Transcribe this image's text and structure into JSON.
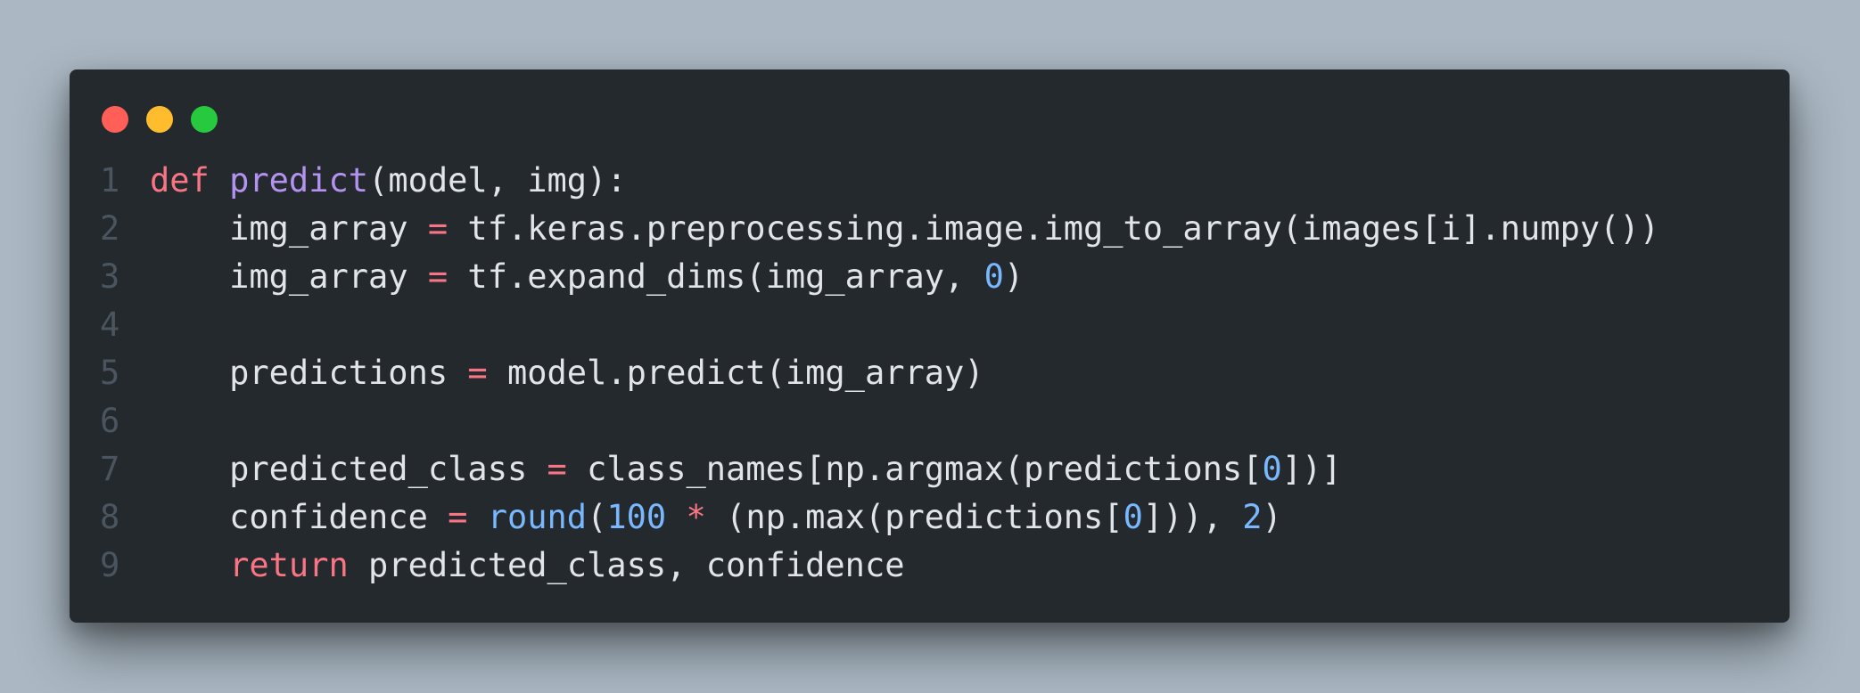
{
  "window": {
    "controls": [
      {
        "name": "close",
        "color": "#ff5f56"
      },
      {
        "name": "minimize",
        "color": "#ffbd2e"
      },
      {
        "name": "maximize",
        "color": "#27c93f"
      }
    ]
  },
  "colors": {
    "background": "#abb8c3",
    "editor_bg": "#24292e",
    "default": "#e1e4e8",
    "keyword": "#f97583",
    "function": "#b392f0",
    "number": "#79b8ff",
    "line_number": "#4b555f"
  },
  "code": {
    "lines": [
      {
        "num": "1",
        "tokens": [
          {
            "t": "def",
            "c": "keyword"
          },
          {
            "t": " ",
            "c": "default"
          },
          {
            "t": "predict",
            "c": "function"
          },
          {
            "t": "(model, img):",
            "c": "default"
          }
        ]
      },
      {
        "num": "2",
        "tokens": [
          {
            "t": "    img_array ",
            "c": "default"
          },
          {
            "t": "=",
            "c": "keyword"
          },
          {
            "t": " tf.keras.preprocessing.image.img_to_array(images[i].numpy())",
            "c": "default"
          }
        ]
      },
      {
        "num": "3",
        "tokens": [
          {
            "t": "    img_array ",
            "c": "default"
          },
          {
            "t": "=",
            "c": "keyword"
          },
          {
            "t": " tf.expand_dims(img_array, ",
            "c": "default"
          },
          {
            "t": "0",
            "c": "number"
          },
          {
            "t": ")",
            "c": "default"
          }
        ]
      },
      {
        "num": "4",
        "tokens": []
      },
      {
        "num": "5",
        "tokens": [
          {
            "t": "    predictions ",
            "c": "default"
          },
          {
            "t": "=",
            "c": "keyword"
          },
          {
            "t": " model.predict(img_array)",
            "c": "default"
          }
        ]
      },
      {
        "num": "6",
        "tokens": []
      },
      {
        "num": "7",
        "tokens": [
          {
            "t": "    predicted_class ",
            "c": "default"
          },
          {
            "t": "=",
            "c": "keyword"
          },
          {
            "t": " class_names[np.argmax(predictions[",
            "c": "default"
          },
          {
            "t": "0",
            "c": "number"
          },
          {
            "t": "])]",
            "c": "default"
          }
        ]
      },
      {
        "num": "8",
        "tokens": [
          {
            "t": "    confidence ",
            "c": "default"
          },
          {
            "t": "=",
            "c": "keyword"
          },
          {
            "t": " ",
            "c": "default"
          },
          {
            "t": "round",
            "c": "number"
          },
          {
            "t": "(",
            "c": "default"
          },
          {
            "t": "100",
            "c": "number"
          },
          {
            "t": " ",
            "c": "default"
          },
          {
            "t": "*",
            "c": "keyword"
          },
          {
            "t": " (np.max(predictions[",
            "c": "default"
          },
          {
            "t": "0",
            "c": "number"
          },
          {
            "t": "])), ",
            "c": "default"
          },
          {
            "t": "2",
            "c": "number"
          },
          {
            "t": ")",
            "c": "default"
          }
        ]
      },
      {
        "num": "9",
        "tokens": [
          {
            "t": "    ",
            "c": "default"
          },
          {
            "t": "return",
            "c": "keyword"
          },
          {
            "t": " predicted_class, confidence",
            "c": "default"
          }
        ]
      }
    ]
  }
}
